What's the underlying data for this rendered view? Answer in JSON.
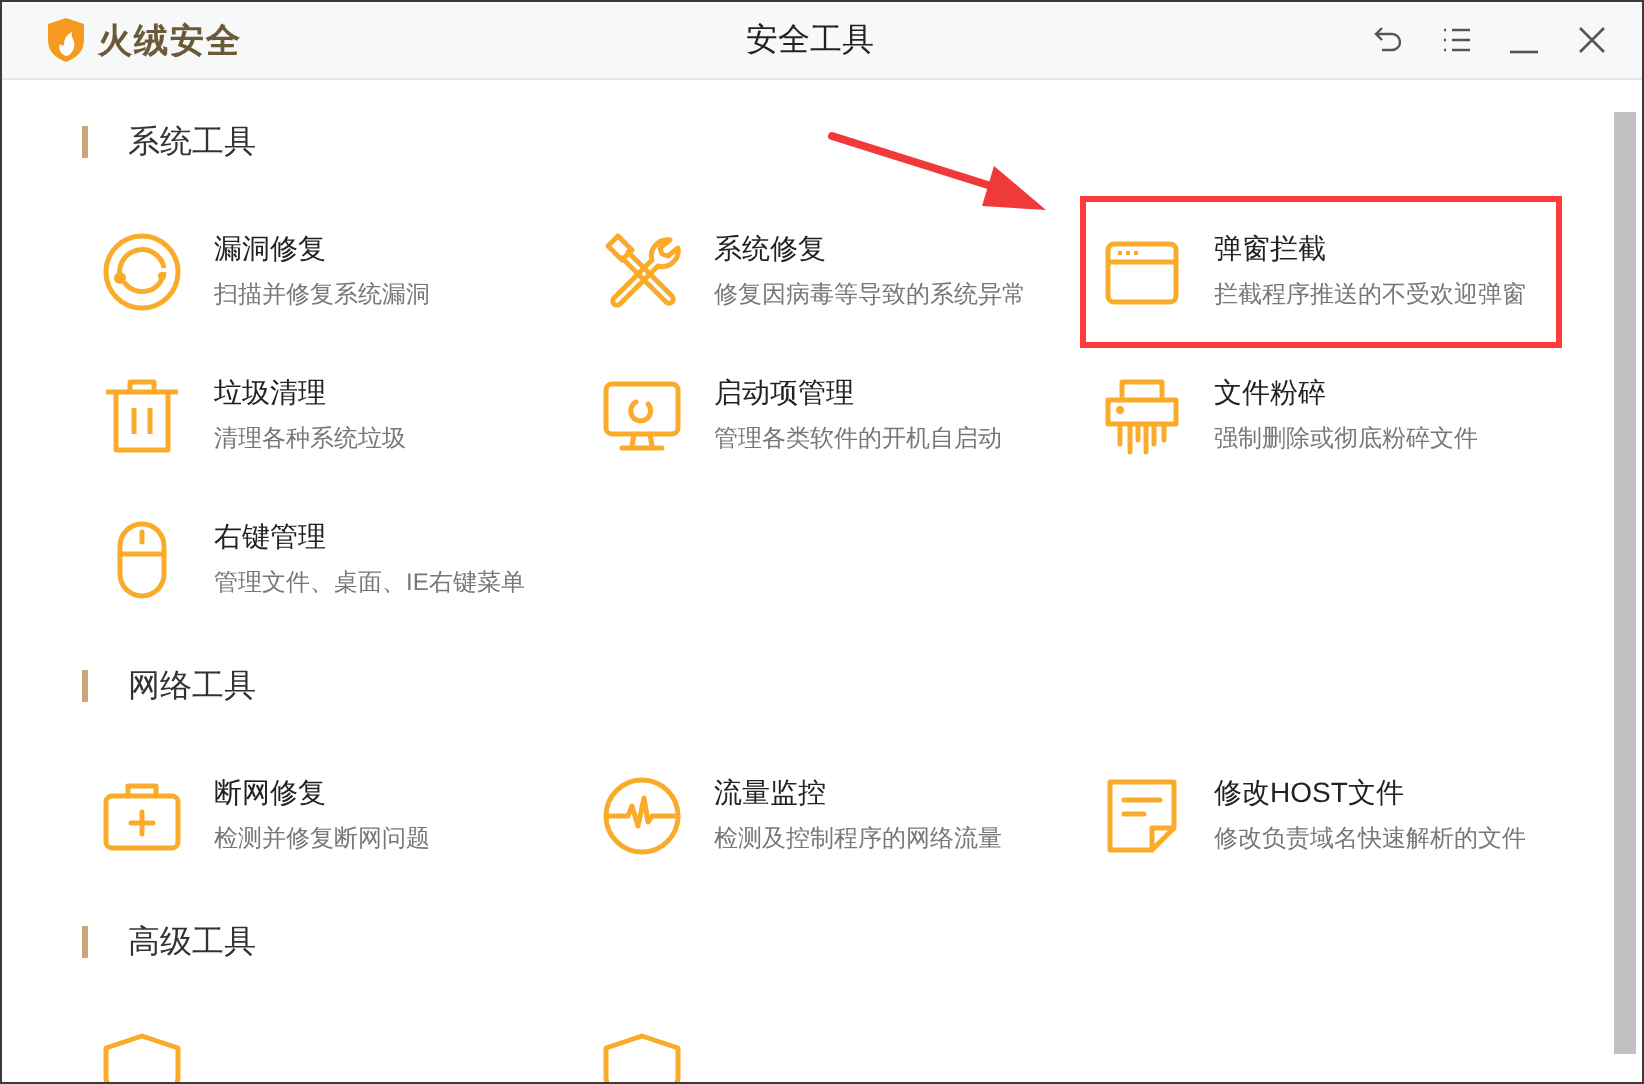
{
  "window": {
    "brand": "火绒安全",
    "title": "安全工具"
  },
  "sections": [
    {
      "title": "系统工具",
      "items": [
        {
          "kind": "vuln",
          "name": "漏洞修复",
          "desc": "扫描并修复系统漏洞",
          "highlighted": false
        },
        {
          "kind": "tools",
          "name": "系统修复",
          "desc": "修复因病毒等导致的系统异常",
          "highlighted": false
        },
        {
          "kind": "popup",
          "name": "弹窗拦截",
          "desc": "拦截程序推送的不受欢迎弹窗",
          "highlighted": true
        },
        {
          "kind": "trash",
          "name": "垃圾清理",
          "desc": "清理各种系统垃圾",
          "highlighted": false
        },
        {
          "kind": "monitor",
          "name": "启动项管理",
          "desc": "管理各类软件的开机自启动",
          "highlighted": false
        },
        {
          "kind": "shredder",
          "name": "文件粉碎",
          "desc": "强制删除或彻底粉碎文件",
          "highlighted": false
        },
        {
          "kind": "mouse",
          "name": "右键管理",
          "desc": "管理文件、桌面、IE右键菜单",
          "highlighted": false
        }
      ]
    },
    {
      "title": "网络工具",
      "items": [
        {
          "kind": "kit",
          "name": "断网修复",
          "desc": "检测并修复断网问题",
          "highlighted": false
        },
        {
          "kind": "pulse",
          "name": "流量监控",
          "desc": "检测及控制程序的网络流量",
          "highlighted": false
        },
        {
          "kind": "file",
          "name": "修改HOST文件",
          "desc": "修改负责域名快速解析的文件",
          "highlighted": false
        }
      ]
    },
    {
      "title": "高级工具",
      "items": [
        {
          "kind": "shield"
        },
        {
          "kind": "shield"
        }
      ]
    }
  ]
}
